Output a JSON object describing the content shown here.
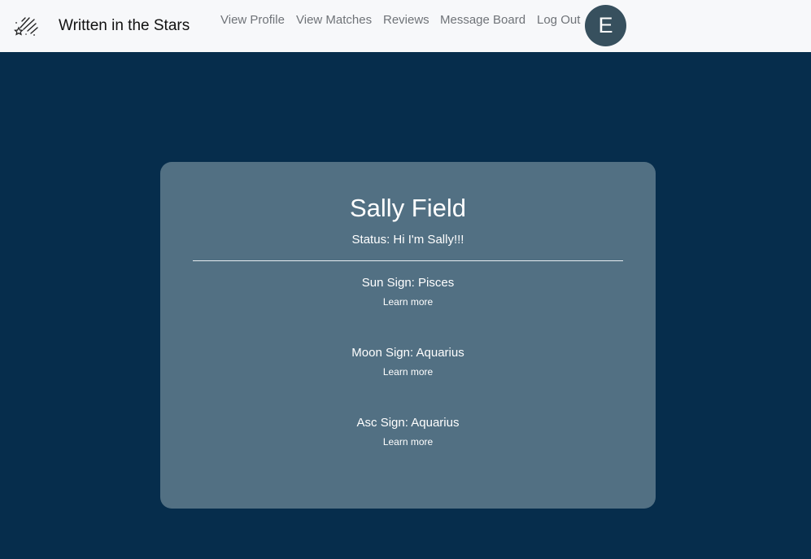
{
  "navbar": {
    "brand_icon": "shooting-stars-icon",
    "brand_title": "Written in the Stars",
    "links": [
      {
        "label": "View Profile"
      },
      {
        "label": "View Matches"
      },
      {
        "label": "Reviews"
      },
      {
        "label": "Message Board"
      },
      {
        "label": "Log Out"
      }
    ],
    "avatar_letter": "E",
    "avatar_color": "#37505e"
  },
  "profile": {
    "name": "Sally Field",
    "status": "Status: Hi I'm Sally!!!",
    "signs": [
      {
        "title": "Sun Sign: Pisces",
        "link": "Learn more"
      },
      {
        "title": "Moon Sign: Aquarius",
        "link": "Learn more"
      },
      {
        "title": "Asc Sign: Aquarius",
        "link": "Learn more"
      }
    ]
  },
  "colors": {
    "page_background": "#062d4c",
    "card_background": "#527083",
    "navbar_background": "#f7f8fa"
  }
}
